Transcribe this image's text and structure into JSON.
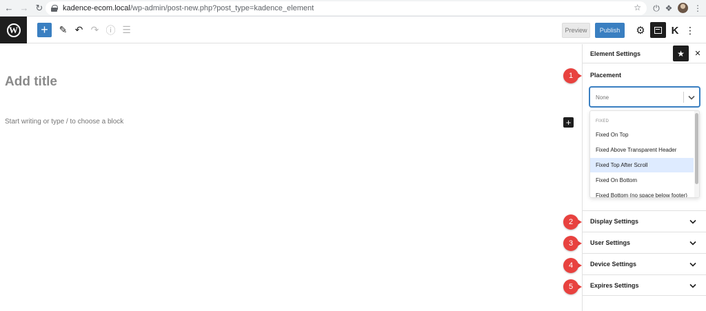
{
  "browser": {
    "url_host": "kadence-ecom.local",
    "url_path": "/wp-admin/post-new.php?post_type=kadence_element"
  },
  "toolbar": {
    "preview_label": "Preview",
    "publish_label": "Publish"
  },
  "editor": {
    "title_placeholder": "Add title",
    "body_placeholder": "Start writing or type / to choose a block"
  },
  "sidebar": {
    "title": "Element Settings",
    "placement": {
      "label": "Placement",
      "selected_value": "None",
      "group_label": "FIXED",
      "options": [
        "Fixed On Top",
        "Fixed Above Transparent Header",
        "Fixed Top After Scroll",
        "Fixed On Bottom",
        "Fixed Bottom (no space below footer)"
      ],
      "highlighted_option": "Fixed Top After Scroll"
    },
    "panels": [
      "Display Settings",
      "User Settings",
      "Device Settings",
      "Expires Settings"
    ]
  },
  "markers": [
    "1",
    "2",
    "3",
    "4",
    "5"
  ],
  "colors": {
    "accent": "#3a7fc1",
    "marker": "#e8423f",
    "dark": "#1e1e1e"
  }
}
